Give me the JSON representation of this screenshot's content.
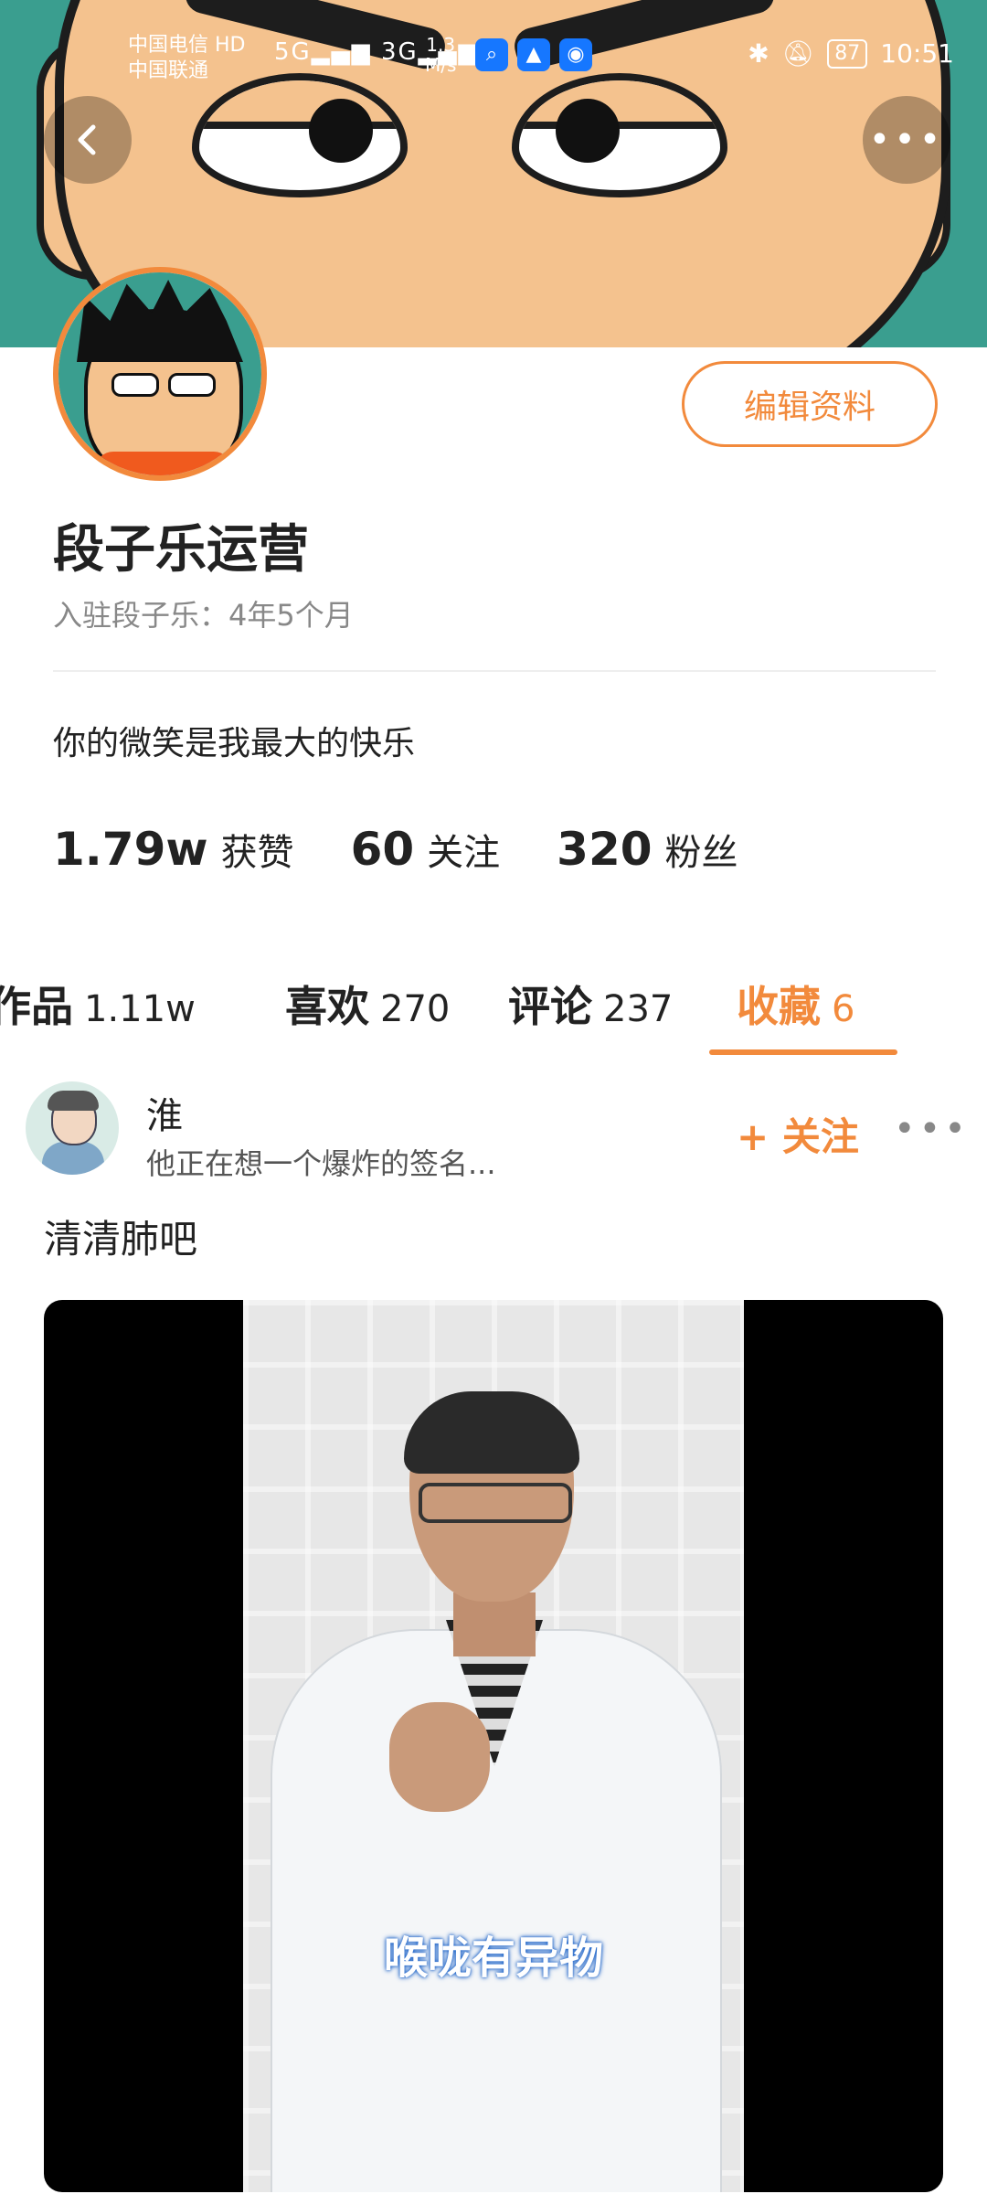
{
  "status_bar": {
    "carrier_1": "中国电信",
    "carrier_hd": "HD",
    "carrier_2": "中国联通",
    "signal_5g": "5G",
    "signal_3g": "3G",
    "net_speed_value": "1.3",
    "net_speed_unit": "M/s",
    "battery": "87",
    "time": "10:51"
  },
  "profile": {
    "name": "段子乐运营",
    "joined": "入驻段子乐：4年5个月",
    "bio": "你的微笑是我最大的快乐",
    "edit_button": "编辑资料",
    "stats": [
      {
        "num": "1.79w",
        "label": "获赞"
      },
      {
        "num": "60",
        "label": "关注"
      },
      {
        "num": "320",
        "label": "粉丝"
      }
    ]
  },
  "tabs": [
    {
      "label": "作品",
      "count": "1.11w"
    },
    {
      "label": "喜欢",
      "count": "270"
    },
    {
      "label": "评论",
      "count": "237"
    },
    {
      "label": "收藏",
      "count": "6"
    }
  ],
  "post": {
    "author": "淮",
    "signature": "他正在想一个爆炸的签名...",
    "follow_label": "+ 关注",
    "caption": "清清肺吧",
    "video_subtitle": "喉咙有异物"
  },
  "colors": {
    "accent": "#f28a3c",
    "banner_bg": "#3a9e8f"
  }
}
